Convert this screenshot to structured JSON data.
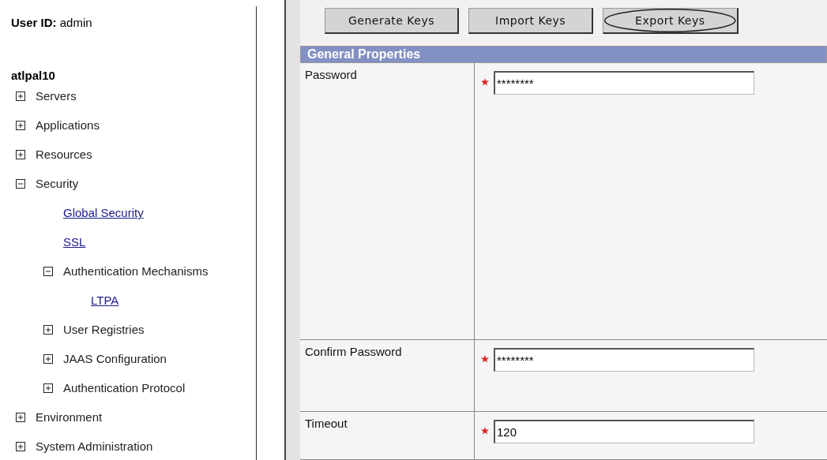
{
  "sidebar": {
    "user_id": {
      "label": "User ID:",
      "value": "admin"
    },
    "node": "atlpal10",
    "tree": [
      {
        "kind": "folder",
        "label": "Servers",
        "expanded": false
      },
      {
        "kind": "folder",
        "label": "Applications",
        "expanded": false
      },
      {
        "kind": "folder",
        "label": "Resources",
        "expanded": false
      },
      {
        "kind": "folder",
        "label": "Security",
        "expanded": true,
        "children": [
          {
            "kind": "link",
            "label": "Global Security"
          },
          {
            "kind": "link",
            "label": "SSL"
          },
          {
            "kind": "folder",
            "label": "Authentication Mechanisms",
            "expanded": true,
            "children": [
              {
                "kind": "link",
                "label": "LTPA"
              }
            ]
          },
          {
            "kind": "folder",
            "label": "User Registries",
            "expanded": false
          },
          {
            "kind": "folder",
            "label": "JAAS Configuration",
            "expanded": false
          },
          {
            "kind": "folder",
            "label": "Authentication Protocol",
            "expanded": false
          }
        ]
      },
      {
        "kind": "folder",
        "label": "Environment",
        "expanded": false
      },
      {
        "kind": "folder",
        "label": "System Administration",
        "expanded": false
      }
    ]
  },
  "toolbar": {
    "buttons": [
      {
        "label": "Generate Keys",
        "circled": false
      },
      {
        "label": "Import Keys",
        "circled": false
      },
      {
        "label": "Export Keys",
        "circled": true
      }
    ]
  },
  "properties": {
    "title": "General Properties",
    "fields": [
      {
        "label": "Password",
        "required": true,
        "value": "********"
      },
      {
        "label": "Confirm Password",
        "required": true,
        "value": "********"
      },
      {
        "label": "Timeout",
        "required": true,
        "value": "120"
      }
    ]
  }
}
